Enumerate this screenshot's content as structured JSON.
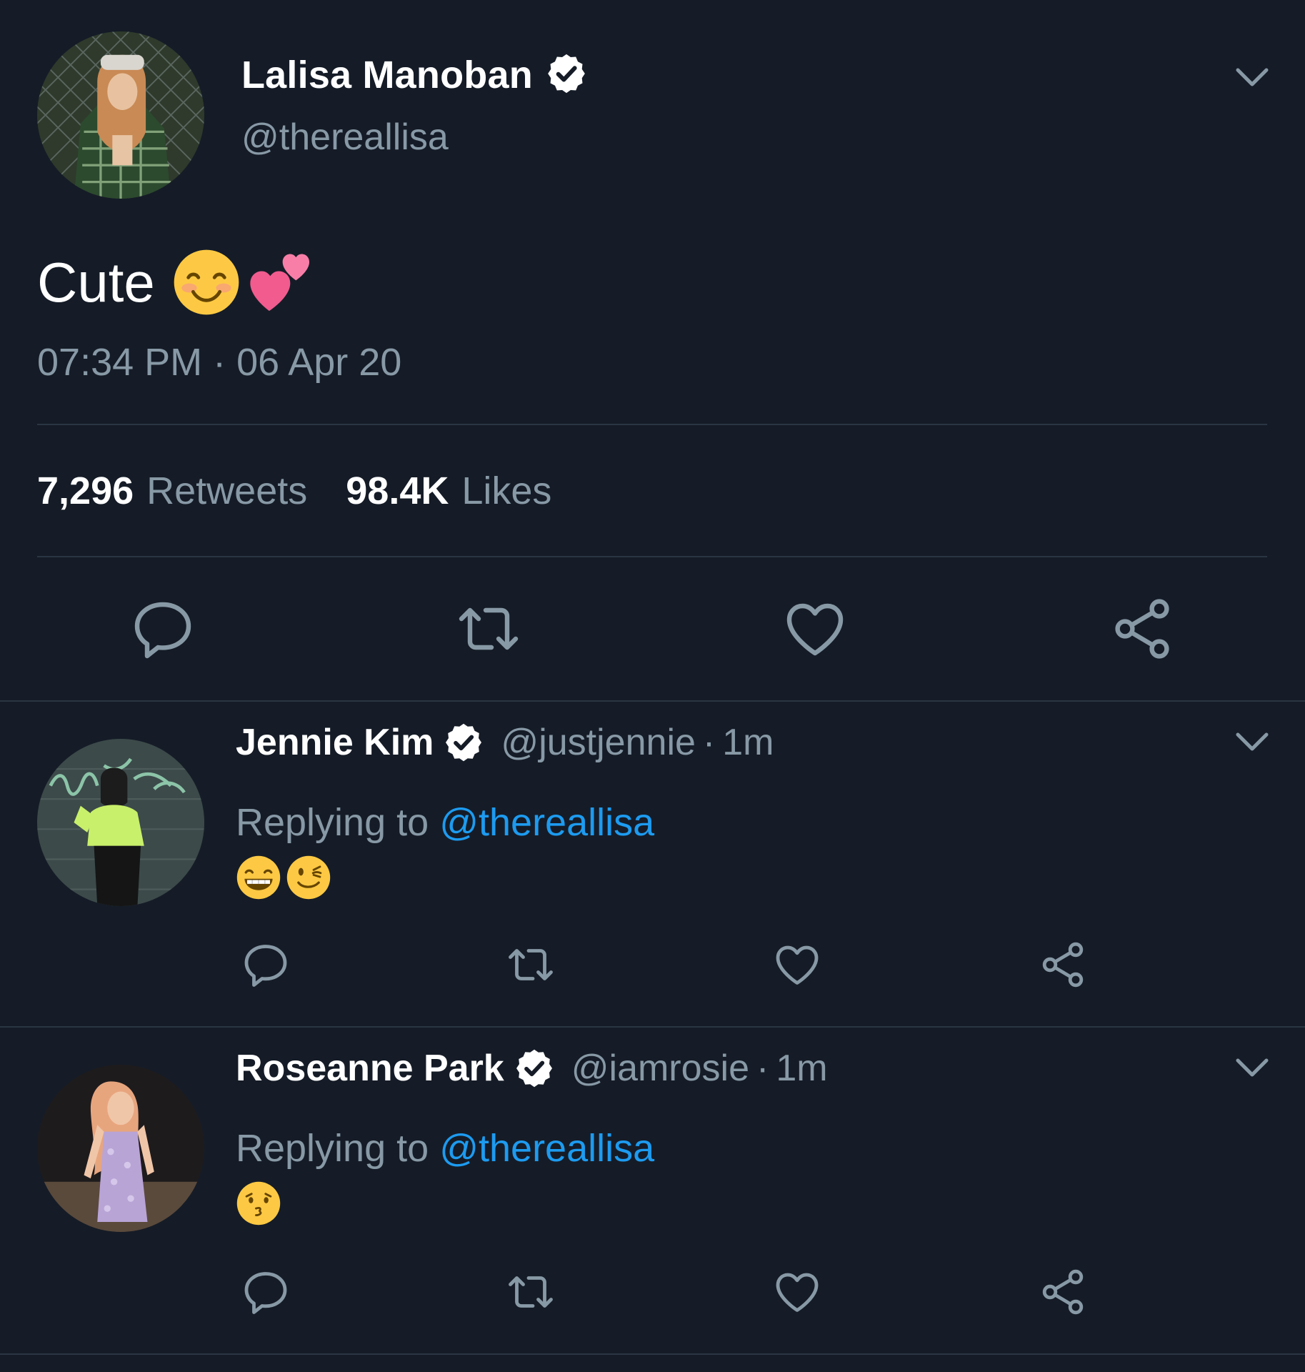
{
  "main_tweet": {
    "author_name": "Lalisa Manoban",
    "author_handle": "@thereallisa",
    "text": "Cute",
    "emojis": [
      "smiling-face-with-smiling-eyes",
      "two-hearts"
    ],
    "timestamp": "07:34 PM · 06 Apr 20",
    "retweets_count": "7,296",
    "retweets_label": "Retweets",
    "likes_count": "98.4K",
    "likes_label": "Likes"
  },
  "replies": [
    {
      "author_name": "Jennie Kim",
      "author_handle": "@justjennie",
      "separator": "·",
      "time": "1m",
      "replying_prefix": "Replying to",
      "replying_mention": "@thereallisa",
      "emojis": [
        "grinning-face",
        "winking-face"
      ]
    },
    {
      "author_name": "Roseanne Park",
      "author_handle": "@iamrosie",
      "separator": "·",
      "time": "1m",
      "replying_prefix": "Replying to",
      "replying_mention": "@thereallisa",
      "emojis": [
        "kissing-face"
      ]
    }
  ],
  "icons": {
    "reply": "speech-bubble-icon",
    "retweet": "retweet-icon",
    "like": "heart-icon",
    "share": "share-icon",
    "menu": "chevron-down-icon",
    "verified": "verified-badge-icon"
  },
  "colors": {
    "background": "#151c27",
    "primary_text": "#ffffff",
    "secondary_text": "#8899a6",
    "link": "#1d9bf0",
    "divider": "#2a3543",
    "icon": "#8899a6"
  }
}
